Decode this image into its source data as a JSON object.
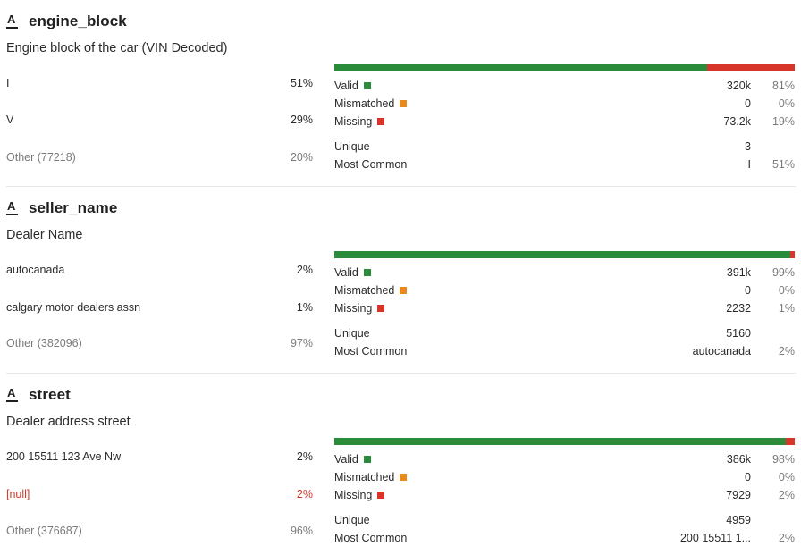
{
  "colors": {
    "valid": "#2a8b3a",
    "mismatched": "#e58a1f",
    "missing": "#d8352a",
    "null_text": "#d23a2a"
  },
  "labels": {
    "valid": "Valid",
    "mismatched": "Mismatched",
    "missing": "Missing",
    "unique": "Unique",
    "most_common": "Most Common"
  },
  "columns": [
    {
      "type_icon": "string-type-icon",
      "type_glyph": "A",
      "name": "engine_block",
      "description": "Engine block of the car (VIN Decoded)",
      "top_values": [
        {
          "label": "I",
          "pct": "51%",
          "style": "normal"
        },
        {
          "label": "V",
          "pct": "29%",
          "style": "normal"
        },
        {
          "label": "Other (77218)",
          "pct": "20%",
          "style": "muted"
        }
      ],
      "quality": {
        "valid_frac": 0.81,
        "mismatched_frac": 0.0,
        "missing_frac": 0.19
      },
      "stats": {
        "valid": {
          "value": "320k",
          "pct": "81%"
        },
        "mismatched": {
          "value": "0",
          "pct": "0%"
        },
        "missing": {
          "value": "73.2k",
          "pct": "19%"
        },
        "unique": {
          "value": "3",
          "pct": ""
        },
        "most_common": {
          "value": "I",
          "pct": "51%"
        }
      }
    },
    {
      "type_icon": "string-type-icon",
      "type_glyph": "A",
      "name": "seller_name",
      "description": "Dealer Name",
      "top_values": [
        {
          "label": "autocanada",
          "pct": "2%",
          "style": "normal"
        },
        {
          "label": "calgary motor dealers assn",
          "pct": "1%",
          "style": "normal"
        },
        {
          "label": "Other (382096)",
          "pct": "97%",
          "style": "muted"
        }
      ],
      "quality": {
        "valid_frac": 0.99,
        "mismatched_frac": 0.0,
        "missing_frac": 0.01
      },
      "stats": {
        "valid": {
          "value": "391k",
          "pct": "99%"
        },
        "mismatched": {
          "value": "0",
          "pct": "0%"
        },
        "missing": {
          "value": "2232",
          "pct": "1%"
        },
        "unique": {
          "value": "5160",
          "pct": ""
        },
        "most_common": {
          "value": "autocanada",
          "pct": "2%"
        }
      }
    },
    {
      "type_icon": "string-type-icon",
      "type_glyph": "A",
      "name": "street",
      "description": "Dealer address street",
      "top_values": [
        {
          "label": "200 15511 123 Ave Nw",
          "pct": "2%",
          "style": "normal"
        },
        {
          "label": "[null]",
          "pct": "2%",
          "style": "null"
        },
        {
          "label": "Other (376687)",
          "pct": "96%",
          "style": "muted"
        }
      ],
      "quality": {
        "valid_frac": 0.98,
        "mismatched_frac": 0.0,
        "missing_frac": 0.02
      },
      "stats": {
        "valid": {
          "value": "386k",
          "pct": "98%"
        },
        "mismatched": {
          "value": "0",
          "pct": "0%"
        },
        "missing": {
          "value": "7929",
          "pct": "2%"
        },
        "unique": {
          "value": "4959",
          "pct": ""
        },
        "most_common": {
          "value": "200 15511 1...",
          "pct": "2%"
        }
      }
    }
  ]
}
